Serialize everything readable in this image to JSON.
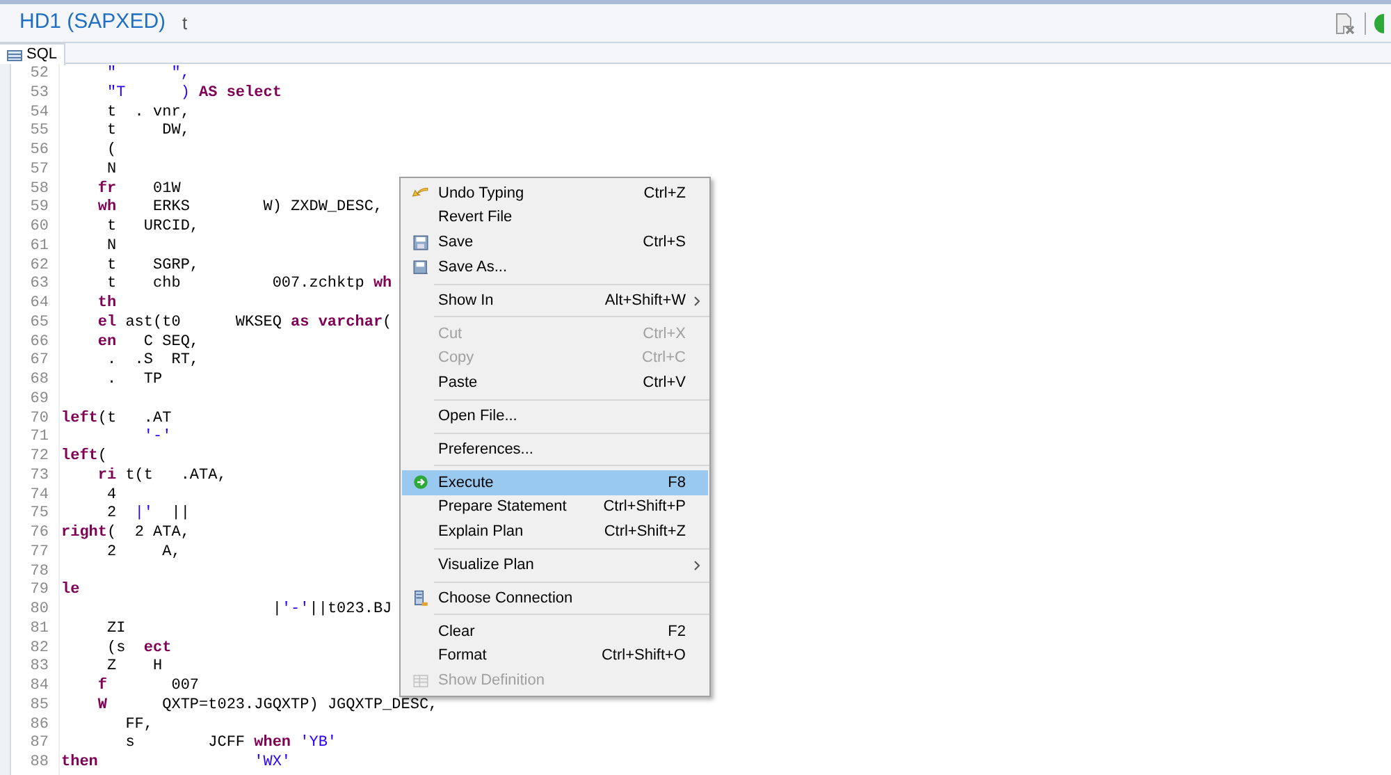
{
  "window": {
    "title": "HD1 (SAPXED)",
    "title_suffix": "t"
  },
  "tabs": [
    {
      "label": "SQL",
      "selected": true
    }
  ],
  "editor": {
    "lines": [
      {
        "number": "52",
        "tokens": [
          {
            "text": "     \"      \",",
            "kind": "string"
          }
        ]
      },
      {
        "number": "53",
        "tokens": [
          {
            "text": "     \"T      ) ",
            "kind": "string"
          },
          {
            "text": "AS select",
            "kind": "keyword"
          }
        ]
      },
      {
        "number": "54",
        "tokens": [
          {
            "text": "     t  . vnr,",
            "kind": "code"
          }
        ]
      },
      {
        "number": "55",
        "tokens": [
          {
            "text": "     t     DW,",
            "kind": "code"
          }
        ]
      },
      {
        "number": "56",
        "tokens": [
          {
            "text": "     (",
            "kind": "code"
          }
        ]
      },
      {
        "number": "57",
        "tokens": [
          {
            "text": "     N",
            "kind": "code"
          }
        ]
      },
      {
        "number": "58",
        "tokens": [
          {
            "text": "    fr",
            "kind": "keyword"
          },
          {
            "text": "    01W",
            "kind": "code"
          }
        ]
      },
      {
        "number": "59",
        "tokens": [
          {
            "text": "    wh",
            "kind": "keyword"
          },
          {
            "text": "    ERKS        W) ZXDW_DESC,",
            "kind": "code"
          }
        ]
      },
      {
        "number": "60",
        "tokens": [
          {
            "text": "     t   URCID,",
            "kind": "code"
          }
        ]
      },
      {
        "number": "61",
        "tokens": [
          {
            "text": "     N",
            "kind": "code"
          }
        ]
      },
      {
        "number": "62",
        "tokens": [
          {
            "text": "     t    SGRP,",
            "kind": "code"
          }
        ]
      },
      {
        "number": "63",
        "tokens": [
          {
            "text": "     t    chb          007.zchktp ",
            "kind": "code"
          },
          {
            "text": "wh",
            "kind": "keyword"
          }
        ]
      },
      {
        "number": "64",
        "tokens": [
          {
            "text": "    th",
            "kind": "keyword"
          }
        ]
      },
      {
        "number": "65",
        "tokens": [
          {
            "text": "    el",
            "kind": "keyword"
          },
          {
            "text": " ast(t0      WKSEQ ",
            "kind": "code"
          },
          {
            "text": "as varchar",
            "kind": "keyword"
          },
          {
            "text": "(",
            "kind": "code"
          }
        ]
      },
      {
        "number": "66",
        "tokens": [
          {
            "text": "    en",
            "kind": "keyword"
          },
          {
            "text": "   C SEQ,",
            "kind": "code"
          }
        ]
      },
      {
        "number": "67",
        "tokens": [
          {
            "text": "     .  .S  RT,",
            "kind": "code"
          }
        ]
      },
      {
        "number": "68",
        "tokens": [
          {
            "text": "     .   TP",
            "kind": "code"
          }
        ]
      },
      {
        "number": "69"
      },
      {
        "number": "70",
        "tokens": [
          {
            "text": "left",
            "kind": "keyword"
          },
          {
            "text": "(t   .AT",
            "kind": "code"
          }
        ]
      },
      {
        "number": "71",
        "tokens": [
          {
            "text": "         '-'",
            "kind": "string"
          }
        ]
      },
      {
        "number": "72",
        "tokens": [
          {
            "text": "left",
            "kind": "keyword"
          },
          {
            "text": "(",
            "kind": "code"
          }
        ]
      },
      {
        "number": "73",
        "tokens": [
          {
            "text": "    ri",
            "kind": "keyword"
          },
          {
            "text": " t(t   .ATA,",
            "kind": "code"
          }
        ]
      },
      {
        "number": "74",
        "tokens": [
          {
            "text": "     4",
            "kind": "code"
          }
        ]
      },
      {
        "number": "75",
        "tokens": [
          {
            "text": "     2  ",
            "kind": "code"
          },
          {
            "text": "|'",
            "kind": "string"
          },
          {
            "text": "  ||",
            "kind": "code"
          }
        ]
      },
      {
        "number": "76",
        "tokens": [
          {
            "text": "right",
            "kind": "keyword"
          },
          {
            "text": "(  2 ATA,",
            "kind": "code"
          }
        ]
      },
      {
        "number": "77",
        "tokens": [
          {
            "text": "     2     A,",
            "kind": "code"
          }
        ]
      },
      {
        "number": "78"
      },
      {
        "number": "79",
        "tokens": [
          {
            "text": "le",
            "kind": "keyword"
          }
        ]
      },
      {
        "number": "80",
        "tokens": [
          {
            "text": "                       |",
            "kind": "code"
          },
          {
            "text": "'-'",
            "kind": "string"
          },
          {
            "text": "||t023.BJ",
            "kind": "code"
          }
        ]
      },
      {
        "number": "81",
        "tokens": [
          {
            "text": "     ZI",
            "kind": "code"
          }
        ]
      },
      {
        "number": "82",
        "tokens": [
          {
            "text": "     (s  ",
            "kind": "code"
          },
          {
            "text": "ect",
            "kind": "keyword"
          }
        ]
      },
      {
        "number": "83",
        "tokens": [
          {
            "text": "     Z    H",
            "kind": "code"
          }
        ]
      },
      {
        "number": "84",
        "tokens": [
          {
            "text": "    f",
            "kind": "keyword"
          },
          {
            "text": "       007",
            "kind": "code"
          }
        ]
      },
      {
        "number": "85",
        "tokens": [
          {
            "text": "    W",
            "kind": "keyword"
          },
          {
            "text": "      QXTP=t023.JGQXTP) JGQXTP_DESC,",
            "kind": "code"
          }
        ]
      },
      {
        "number": "86",
        "tokens": [
          {
            "text": "       FF,",
            "kind": "code"
          }
        ]
      },
      {
        "number": "87",
        "tokens": [
          {
            "text": "       s        JCFF ",
            "kind": "code"
          },
          {
            "text": "when",
            "kind": "keyword"
          },
          {
            "text": " 'YB'",
            "kind": "string"
          }
        ]
      },
      {
        "number": "88",
        "tokens": [
          {
            "text": "then",
            "kind": "keyword"
          },
          {
            "text": "                 'WX'",
            "kind": "string"
          }
        ]
      }
    ]
  },
  "context_menu": {
    "items": [
      {
        "kind": "item",
        "label": "Undo Typing",
        "shortcut": "Ctrl+Z",
        "disabled": false,
        "selected": false
      },
      {
        "kind": "item",
        "label": "Revert File",
        "disabled": false,
        "selected": false
      },
      {
        "kind": "item",
        "label": "Save",
        "shortcut": "Ctrl+S",
        "disabled": false,
        "selected": false
      },
      {
        "kind": "item",
        "label": "Save As...",
        "disabled": false,
        "selected": false
      },
      {
        "kind": "separator"
      },
      {
        "kind": "item",
        "label": "Show In",
        "shortcut": "Alt+Shift+W",
        "submenu": true,
        "disabled": false,
        "selected": false
      },
      {
        "kind": "separator"
      },
      {
        "kind": "item",
        "label": "Cut",
        "shortcut": "Ctrl+X",
        "disabled": true,
        "selected": false
      },
      {
        "kind": "item",
        "label": "Copy",
        "shortcut": "Ctrl+C",
        "disabled": true,
        "selected": false
      },
      {
        "kind": "item",
        "label": "Paste",
        "shortcut": "Ctrl+V",
        "disabled": false,
        "selected": false
      },
      {
        "kind": "separator"
      },
      {
        "kind": "item",
        "label": "Open File...",
        "disabled": false,
        "selected": false
      },
      {
        "kind": "separator"
      },
      {
        "kind": "item",
        "label": "Preferences...",
        "disabled": false,
        "selected": false
      },
      {
        "kind": "separator"
      },
      {
        "kind": "item",
        "label": "Execute",
        "shortcut": "F8",
        "disabled": false,
        "selected": true
      },
      {
        "kind": "item",
        "label": "Prepare Statement",
        "shortcut": "Ctrl+Shift+P",
        "disabled": false,
        "selected": false
      },
      {
        "kind": "item",
        "label": "Explain Plan",
        "shortcut": "Ctrl+Shift+Z",
        "disabled": false,
        "selected": false
      },
      {
        "kind": "separator"
      },
      {
        "kind": "item",
        "label": "Visualize Plan",
        "submenu": true,
        "disabled": false,
        "selected": false
      },
      {
        "kind": "separator"
      },
      {
        "kind": "item",
        "label": "Choose Connection",
        "disabled": false,
        "selected": false
      },
      {
        "kind": "separator"
      },
      {
        "kind": "item",
        "label": "Clear",
        "shortcut": "F2",
        "disabled": false,
        "selected": false
      },
      {
        "kind": "item",
        "label": "Format",
        "shortcut": "Ctrl+Shift+O",
        "disabled": false,
        "selected": false
      },
      {
        "kind": "item",
        "label": "Show Definition",
        "disabled": true,
        "selected": false
      }
    ]
  }
}
